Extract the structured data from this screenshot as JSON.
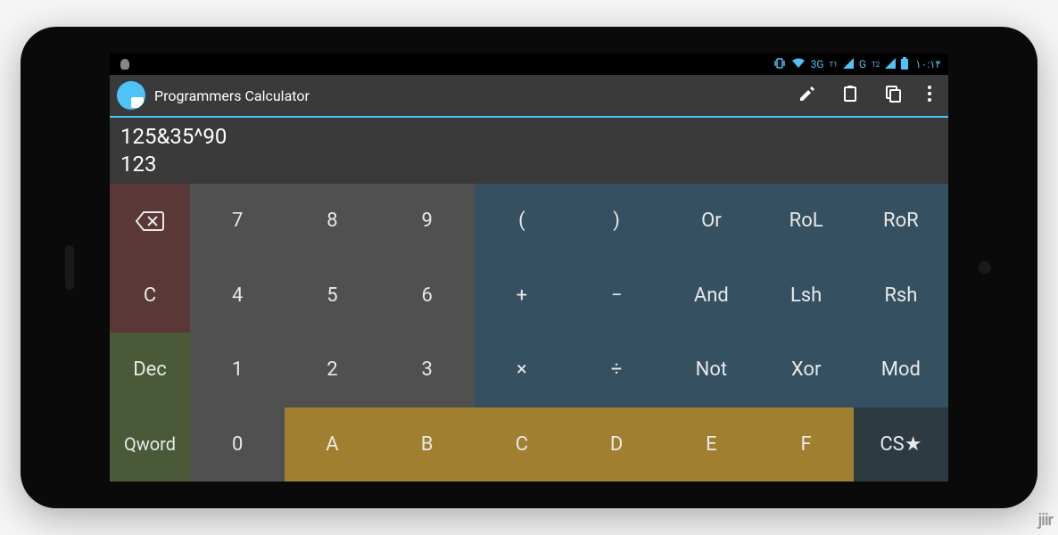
{
  "status": {
    "net1": "3G",
    "sim1": "T1",
    "net2": "G",
    "sim2": "T2",
    "time": "١٠:١۴"
  },
  "app": {
    "title": "Programmers Calculator"
  },
  "display": {
    "expression": "125&35^90",
    "result": "123"
  },
  "keys": {
    "backspace": "⌫",
    "clear": "C",
    "base": "Dec",
    "word": "Qword",
    "n7": "7",
    "n8": "8",
    "n9": "9",
    "n4": "4",
    "n5": "5",
    "n6": "6",
    "n1": "1",
    "n2": "2",
    "n3": "3",
    "n0": "0",
    "hA": "A",
    "hB": "B",
    "hC": "C",
    "hD": "D",
    "hE": "E",
    "hF": "F",
    "lp": "(",
    "rp": ")",
    "or": "Or",
    "rol": "RoL",
    "ror": "RoR",
    "plus": "+",
    "minus": "−",
    "and": "And",
    "lsh": "Lsh",
    "rsh": "Rsh",
    "mul": "×",
    "div": "÷",
    "not": "Not",
    "xor": "Xor",
    "mod": "Mod",
    "cs": "CS★"
  },
  "watermark": "jiir"
}
